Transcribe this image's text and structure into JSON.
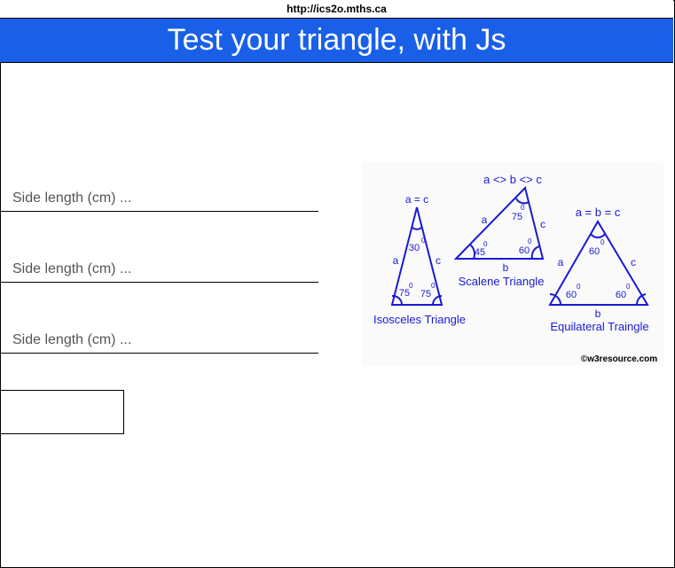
{
  "browser": {
    "url": "http://ics2o.mths.ca"
  },
  "header": {
    "title": "Test your triangle, with Js"
  },
  "form": {
    "side_a_placeholder": "Side length (cm) ...",
    "side_b_placeholder": "Side length (cm) ...",
    "side_c_placeholder": "Side length (cm) ...",
    "button_label": "",
    "result": ""
  },
  "diagram": {
    "isosceles": {
      "top_label": "a = c",
      "side_left": "a",
      "side_right": "c",
      "top_angle": "30",
      "left_angle": "75",
      "right_angle": "75",
      "degree": "0",
      "name": "Isosceles Triangle"
    },
    "scalene": {
      "top_label": "a <> b <> c",
      "side_left": "a",
      "side_right": "c",
      "side_bottom": "b",
      "top_angle": "75",
      "left_angle": "45",
      "right_angle": "60",
      "degree": "0",
      "name": "Scalene Triangle"
    },
    "equilateral": {
      "top_label": "a = b = c",
      "side_left": "a",
      "side_right": "c",
      "side_bottom": "b",
      "top_angle": "60",
      "left_angle": "60",
      "right_angle": "60",
      "degree": "0",
      "name": "Equilateral Traingle"
    },
    "credit": "©w3resource.com",
    "line_color": "#1a1ad4"
  },
  "colors": {
    "header_bg": "#1a5fe8",
    "header_text": "#ffffff"
  }
}
